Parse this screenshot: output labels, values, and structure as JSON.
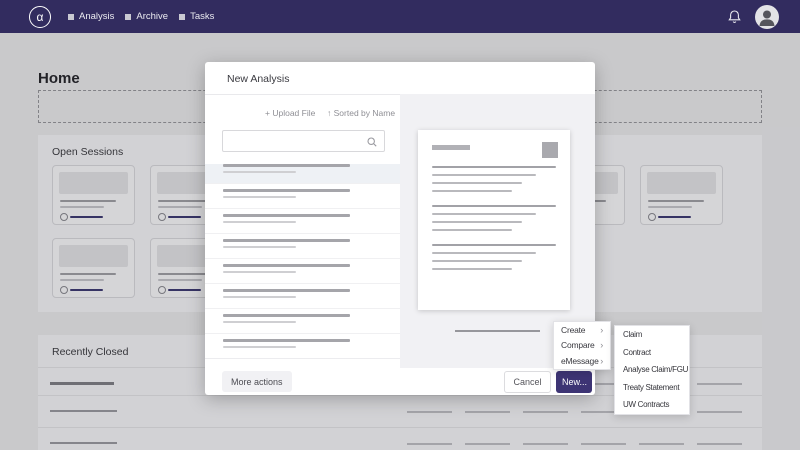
{
  "colors": {
    "navbar": "#322c5f",
    "primary_button": "#3d3474",
    "accent_link": "#3e3a72"
  },
  "navbar": {
    "logo": "α",
    "items": [
      "Analysis",
      "Archive",
      "Tasks"
    ],
    "icons": [
      "bell-icon",
      "user-avatar"
    ]
  },
  "page": {
    "title": "Home"
  },
  "open_sessions": {
    "label": "Open Sessions",
    "card_rows": [
      7,
      2
    ]
  },
  "recently_closed": {
    "label": "Recently Closed",
    "row_count": 3,
    "right_line_count": 6
  },
  "modal": {
    "title": "New Analysis",
    "upload_icon": "+",
    "upload_label": "Upload File",
    "sort_icon": "↑",
    "sort_label": "Sorted by Name",
    "search_placeholder": "",
    "list_item_count": 10,
    "selected_index": 0,
    "more_actions_label": "More actions",
    "cancel_label": "Cancel",
    "new_label": "New..."
  },
  "create_menu": {
    "chevron": "›",
    "items": [
      {
        "label": "Create",
        "has_submenu": true
      },
      {
        "label": "Compare",
        "has_submenu": true
      },
      {
        "label": "eMessage",
        "has_submenu": true
      }
    ]
  },
  "submenu": {
    "items": [
      "Claim",
      "Contract",
      "Analyse Claim/FGU",
      "Treaty Statement",
      "UW Contracts"
    ]
  },
  "placeholders": {
    "file_item_line_widths": [
      127,
      73
    ],
    "preview_group_count": 3,
    "preview_line_widths": [
      124,
      104,
      90,
      80
    ],
    "closed_left_line_widths": [
      64,
      67,
      67
    ],
    "closed_right_line_width": 45
  }
}
